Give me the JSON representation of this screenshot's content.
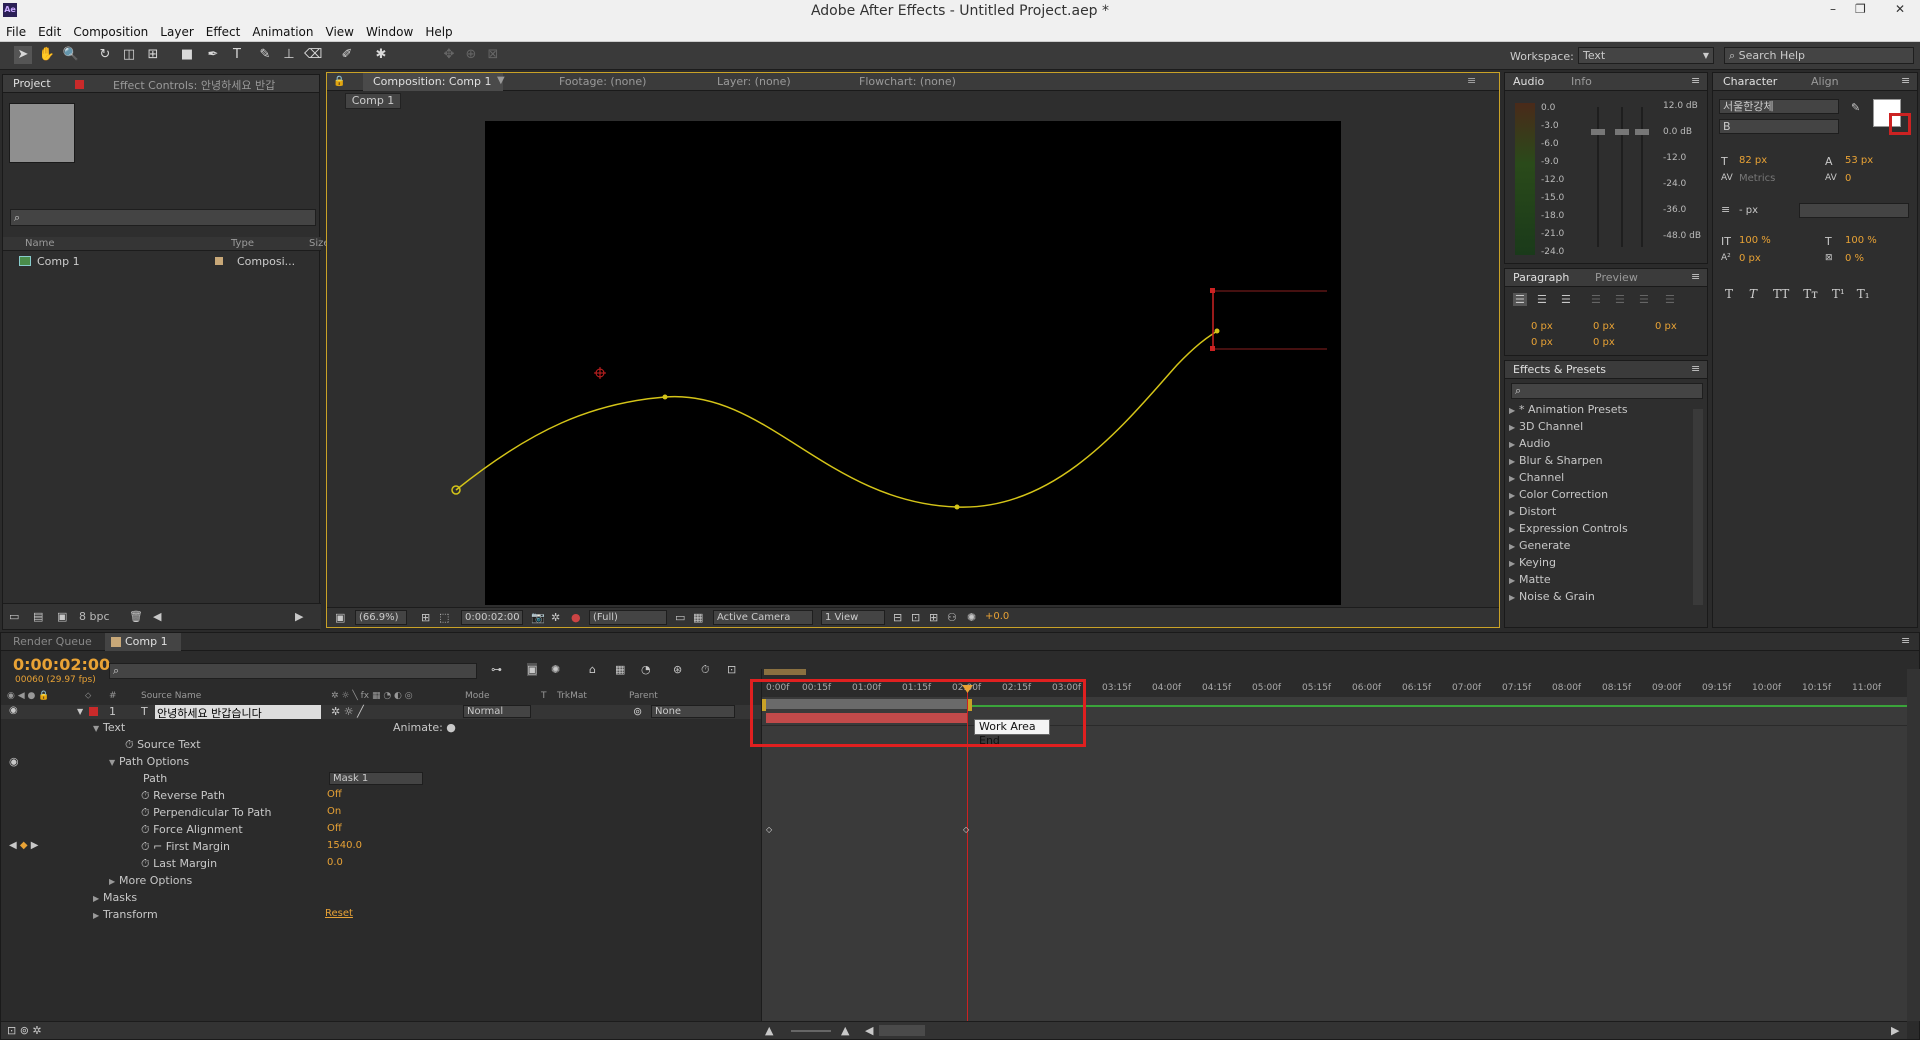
{
  "window": {
    "title": "Adobe After Effects - Untitled Project.aep *",
    "logo": "Ae",
    "minimize": "–",
    "restore": "❐",
    "close": "✕"
  },
  "menu": [
    "File",
    "Edit",
    "Composition",
    "Layer",
    "Effect",
    "Animation",
    "View",
    "Window",
    "Help"
  ],
  "toolbar": {
    "workspace_label": "Workspace:",
    "workspace_value": "Text",
    "search_placeholder": "Search Help"
  },
  "project_panel": {
    "tab_project": "Project",
    "tab_effect_controls": "Effect Controls: 안녕하세요 반갑",
    "col_name": "Name",
    "col_type": "Type",
    "col_size": "Size",
    "item_name": "Comp 1",
    "item_type": "Composi...",
    "bpc": "8 bpc"
  },
  "comp_panel": {
    "tab_comp": "Composition: Comp 1",
    "tab_footage": "Footage: (none)",
    "tab_layer": "Layer: (none)",
    "tab_flowchart": "Flowchart: (none)",
    "breadcrumb": "Comp 1",
    "zoom": "(66.9%)",
    "timecode": "0:00:02:00",
    "resolution": "(Full)",
    "camera": "Active Camera",
    "views": "1 View",
    "exposure": "+0.0"
  },
  "audio_panel": {
    "tab_audio": "Audio",
    "tab_info": "Info",
    "levels_left": [
      "0.0",
      "-3.0",
      "-6.0",
      "-9.0",
      "-12.0",
      "-15.0",
      "-18.0",
      "-21.0",
      "-24.0"
    ],
    "levels_right": [
      "12.0 dB",
      "0.0 dB",
      "-12.0",
      "-24.0",
      "-36.0",
      "-48.0 dB"
    ]
  },
  "paragraph_panel": {
    "tab_paragraph": "Paragraph",
    "tab_preview": "Preview",
    "px_values": [
      "0 px",
      "0 px",
      "0 px",
      "0 px",
      "0 px"
    ]
  },
  "effects_panel": {
    "tab": "Effects & Presets",
    "items": [
      "* Animation Presets",
      "3D Channel",
      "Audio",
      "Blur & Sharpen",
      "Channel",
      "Color Correction",
      "Distort",
      "Expression Controls",
      "Generate",
      "Keying",
      "Matte",
      "Noise & Grain"
    ]
  },
  "character_panel": {
    "tab_character": "Character",
    "tab_align": "Align",
    "font": "서울한강체",
    "style": "B",
    "font_size": "82 px",
    "leading": "53 px",
    "kerning": "Metrics",
    "tracking": "0",
    "stroke": "- px",
    "vscale": "100 %",
    "hscale": "100 %",
    "baseline": "0 px",
    "tsume": "0 %",
    "style_buttons": [
      "T",
      "T",
      "TT",
      "Tт",
      "T¹",
      "T₁"
    ]
  },
  "timeline": {
    "tab_render": "Render Queue",
    "tab_comp": "Comp 1",
    "timecode": "0:00:02:00",
    "fps": "00060 (29.97 fps)",
    "col_source": "Source Name",
    "col_mode": "Mode",
    "col_t": "T",
    "col_trkmat": "TrkMat",
    "col_parent": "Parent",
    "layer_num": "1",
    "layer_name": "안녕하세요 반갑습니다",
    "layer_mode": "Normal",
    "layer_parent": "None",
    "animate_label": "Animate:",
    "tooltip": "Work Area End",
    "ruler": [
      "0:00f",
      "00:15f",
      "01:00f",
      "01:15f",
      "02:00f",
      "02:15f",
      "03:00f",
      "03:15f",
      "04:00f",
      "04:15f",
      "05:00f",
      "05:15f",
      "06:00f",
      "06:15f",
      "07:00f",
      "07:15f",
      "08:00f",
      "08:15f",
      "09:00f",
      "09:15f",
      "10:00f",
      "10:15f",
      "11:00f"
    ],
    "props": [
      {
        "name": "Text",
        "value": ""
      },
      {
        "name": "Source Text",
        "value": ""
      },
      {
        "name": "Path Options",
        "value": ""
      },
      {
        "name": "Path",
        "value": "Mask 1"
      },
      {
        "name": "Reverse Path",
        "value": "Off"
      },
      {
        "name": "Perpendicular To Path",
        "value": "On"
      },
      {
        "name": "Force Alignment",
        "value": "Off"
      },
      {
        "name": "First Margin",
        "value": "1540.0"
      },
      {
        "name": "Last Margin",
        "value": "0.0"
      },
      {
        "name": "More Options",
        "value": ""
      },
      {
        "name": "Masks",
        "value": ""
      },
      {
        "name": "Transform",
        "value": "Reset"
      }
    ]
  }
}
